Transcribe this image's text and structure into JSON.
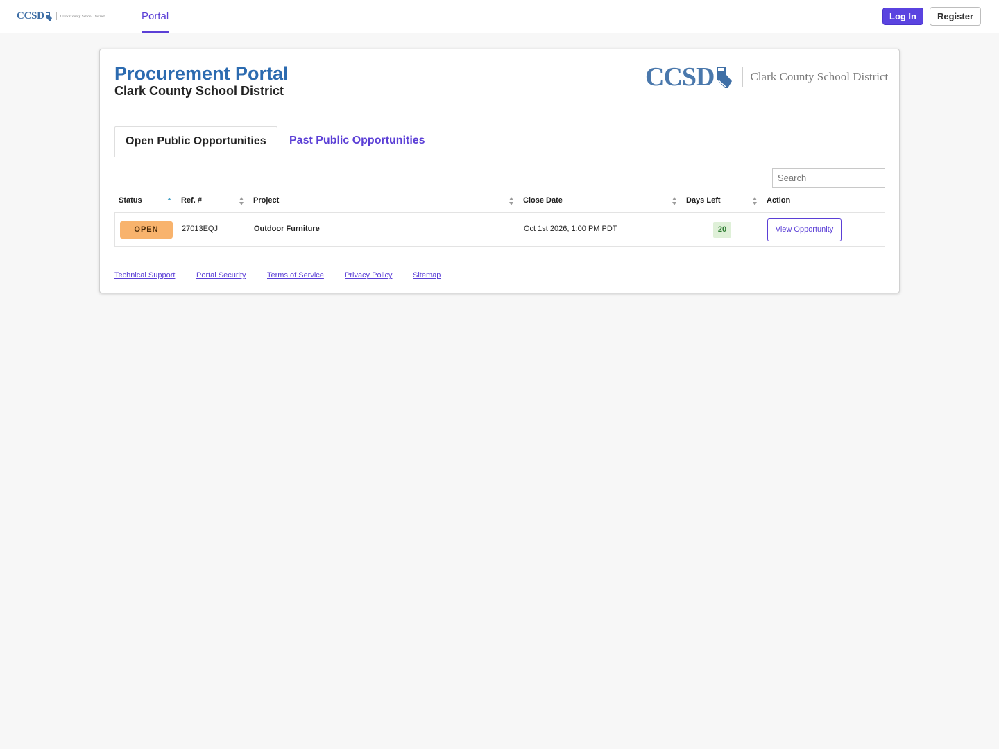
{
  "nav": {
    "logo_mark": "CCSD",
    "logo_name": "Clark County School District",
    "tab_portal": "Portal",
    "login_label": "Log In",
    "register_label": "Register"
  },
  "header": {
    "title": "Procurement Portal",
    "subtitle": "Clark County School District",
    "logo_mark": "CCSD",
    "logo_name": "Clark County School District"
  },
  "tabs": [
    {
      "label": "Open Public Opportunities",
      "active": true
    },
    {
      "label": "Past Public Opportunities",
      "active": false
    }
  ],
  "search": {
    "placeholder": "Search",
    "value": ""
  },
  "table": {
    "columns": [
      "Status",
      "Ref. #",
      "Project",
      "Close Date",
      "Days Left",
      "Action"
    ],
    "rows": [
      {
        "status": "OPEN",
        "ref": "27013EQJ",
        "project": "Outdoor Furniture",
        "close_date": "Oct 1st 2026, 1:00 PM PDT",
        "days_left": "20",
        "action": "View Opportunity"
      }
    ]
  },
  "footer": {
    "links": [
      "Technical Support",
      "Portal Security",
      "Terms of Service",
      "Privacy Policy",
      "Sitemap"
    ]
  },
  "colors": {
    "accent": "#5b3fd6",
    "title_blue": "#2c6bb0",
    "status_open": "#f8b36d",
    "days_badge": "#dff0d8"
  }
}
